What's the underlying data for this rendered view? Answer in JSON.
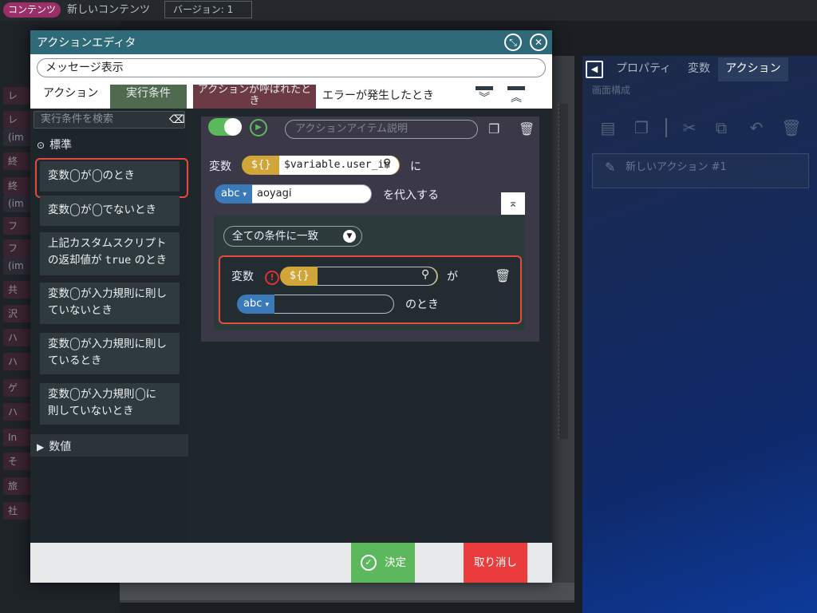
{
  "topbar": {
    "badge": "コンテンツ",
    "title": "新しいコンテンツ",
    "version": "バージョン: 1"
  },
  "background_left": {
    "items": [
      "レ",
      "レ",
      "(im",
      "終",
      "終",
      "(im",
      "フ",
      "フ",
      "(im",
      "共",
      "沢",
      "ハ",
      "ハ",
      "ゲ",
      "ハ",
      "In",
      "そ",
      "旅",
      "社"
    ]
  },
  "right_panel": {
    "tabs": [
      "プロパティ",
      "変数",
      "アクション"
    ],
    "active_tab": "アクション",
    "section_label": "画面構成",
    "new_action_label": "新しいアクション #1"
  },
  "dialog": {
    "title": "アクションエディタ",
    "name_value": "メッセージ表示",
    "tabs": {
      "action": "アクション",
      "condition": "実行条件",
      "called": "アクションが呼ばれたとき",
      "error": "エラーが発生したとき"
    },
    "search_placeholder": "実行条件を検索",
    "categories": {
      "standard": "標準",
      "number": "数値"
    },
    "condition_items": [
      {
        "parts": [
          "変数",
          "が",
          "のとき"
        ]
      },
      {
        "parts": [
          "変数",
          "が",
          "でないとき"
        ]
      },
      {
        "line1": "上記カスタムスクリプト",
        "line2a": "の返却値が",
        "line2b": "true",
        "line2c": "のとき"
      },
      {
        "line1a": "変数",
        "line1b": "が入力規則に則し",
        "line2": "ていないとき"
      },
      {
        "line1a": "変数",
        "line1b": "が入力規則に則し",
        "line2": "ているとき"
      },
      {
        "line1a": "変数",
        "line1b": "が入力規則",
        "line1c": "に",
        "line2": "則していないとき"
      }
    ],
    "editor": {
      "description_placeholder": "アクションアイテム説明",
      "var_label": "変数",
      "var_type": "${}",
      "var_value": "$variable.user_in",
      "ni": "に",
      "value_type": "abc",
      "value": "aoyagi",
      "assign": "を代入する",
      "match_select": "全ての条件に一致",
      "condition": {
        "var_label": "変数",
        "var_type": "${}",
        "ga": "が",
        "value_type": "abc",
        "notoki": "のとき"
      }
    },
    "footer": {
      "ok": "決定",
      "cancel": "取り消し"
    }
  },
  "colors": {
    "accent_title": "#2e6a78",
    "ok": "#5cb85c",
    "cancel": "#ea3c3c",
    "highlight": "#e64a3c",
    "var_pill": "#d0a53a",
    "type_pill": "#3a7ab8"
  }
}
